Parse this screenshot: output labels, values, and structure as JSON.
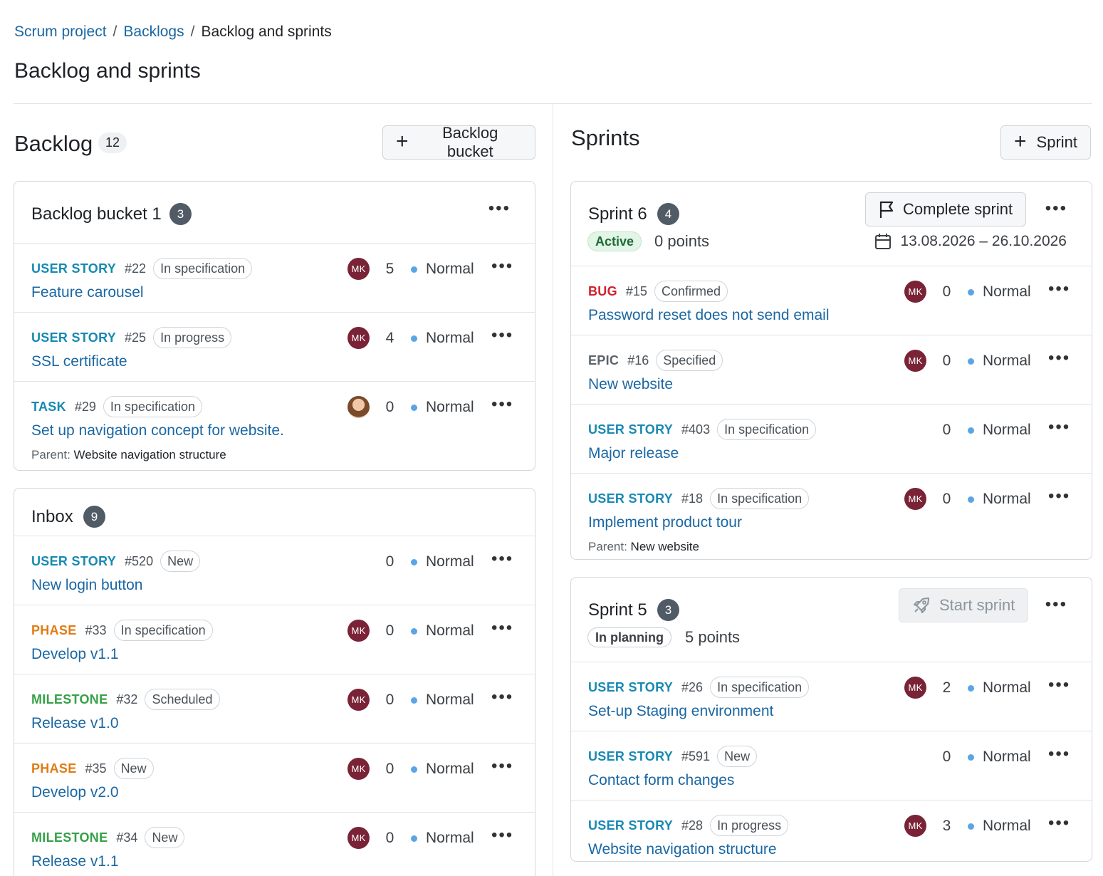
{
  "breadcrumb": {
    "project": "Scrum project",
    "backlogs": "Backlogs",
    "current": "Backlog and sprints"
  },
  "page_title": "Backlog and sprints",
  "backlog": {
    "title": "Backlog",
    "count": "12",
    "add_button": "Backlog bucket",
    "buckets": [
      {
        "title": "Backlog bucket 1",
        "count": "3",
        "items": [
          {
            "type": "USER STORY",
            "num": "#22",
            "status": "In specification",
            "subject": "Feature carousel",
            "assignee": "MK",
            "points": "5",
            "priority": "Normal"
          },
          {
            "type": "USER STORY",
            "num": "#25",
            "status": "In progress",
            "subject": "SSL certificate",
            "assignee": "MK",
            "points": "4",
            "priority": "Normal"
          },
          {
            "type": "TASK",
            "num": "#29",
            "status": "In specification",
            "subject": "Set up navigation concept for website.",
            "points": "0",
            "priority": "Normal",
            "parent_label": "Parent:",
            "parent": "Website navigation structure"
          }
        ]
      },
      {
        "title": "Inbox",
        "count": "9",
        "items": [
          {
            "type": "USER STORY",
            "num": "#520",
            "status": "New",
            "subject": "New login button",
            "points": "0",
            "priority": "Normal"
          },
          {
            "type": "PHASE",
            "num": "#33",
            "status": "In specification",
            "subject": "Develop v1.1",
            "assignee": "MK",
            "points": "0",
            "priority": "Normal"
          },
          {
            "type": "MILESTONE",
            "num": "#32",
            "status": "Scheduled",
            "subject": "Release v1.0",
            "assignee": "MK",
            "points": "0",
            "priority": "Normal"
          },
          {
            "type": "PHASE",
            "num": "#35",
            "status": "New",
            "subject": "Develop v2.0",
            "assignee": "MK",
            "points": "0",
            "priority": "Normal"
          },
          {
            "type": "MILESTONE",
            "num": "#34",
            "status": "New",
            "subject": "Release v1.1",
            "assignee": "MK",
            "points": "0",
            "priority": "Normal"
          }
        ]
      }
    ]
  },
  "sprints": {
    "title": "Sprints",
    "add_button": "Sprint",
    "list": [
      {
        "title": "Sprint 6",
        "count": "4",
        "state": "Active",
        "points": "0 points",
        "action": "Complete sprint",
        "dates": "13.08.2026 – 26.10.2026",
        "items": [
          {
            "type": "BUG",
            "num": "#15",
            "status": "Confirmed",
            "subject": "Password reset does not send email",
            "assignee": "MK",
            "points": "0",
            "priority": "Normal"
          },
          {
            "type": "EPIC",
            "num": "#16",
            "status": "Specified",
            "subject": "New website",
            "assignee": "MK",
            "points": "0",
            "priority": "Normal"
          },
          {
            "type": "USER STORY",
            "num": "#403",
            "status": "In specification",
            "subject": "Major release",
            "points": "0",
            "priority": "Normal"
          },
          {
            "type": "USER STORY",
            "num": "#18",
            "status": "In specification",
            "subject": "Implement product tour",
            "assignee": "MK",
            "points": "0",
            "priority": "Normal",
            "parent_label": "Parent:",
            "parent": "New website"
          }
        ]
      },
      {
        "title": "Sprint 5",
        "count": "3",
        "state": "In planning",
        "points": "5 points",
        "action": "Start sprint",
        "items": [
          {
            "type": "USER STORY",
            "num": "#26",
            "status": "In specification",
            "subject": "Set-up Staging environment",
            "assignee": "MK",
            "points": "2",
            "priority": "Normal"
          },
          {
            "type": "USER STORY",
            "num": "#591",
            "status": "New",
            "subject": "Contact form changes",
            "points": "0",
            "priority": "Normal"
          },
          {
            "type": "USER STORY",
            "num": "#28",
            "status": "In progress",
            "subject": "Website navigation structure",
            "assignee": "MK",
            "points": "3",
            "priority": "Normal"
          }
        ]
      }
    ]
  },
  "colors": {
    "link": "#1a67a3",
    "story": "#1789b3",
    "phase": "#e07b14",
    "milestone": "#35a148",
    "bug": "#d0212b",
    "avatar": "#7a2336",
    "priority_normal": "#5aa5e6"
  },
  "icons": {
    "add": "plus-icon",
    "more": "more-horizontal-icon",
    "complete": "flag-icon",
    "start": "rocket-icon",
    "dates": "calendar-icon"
  }
}
